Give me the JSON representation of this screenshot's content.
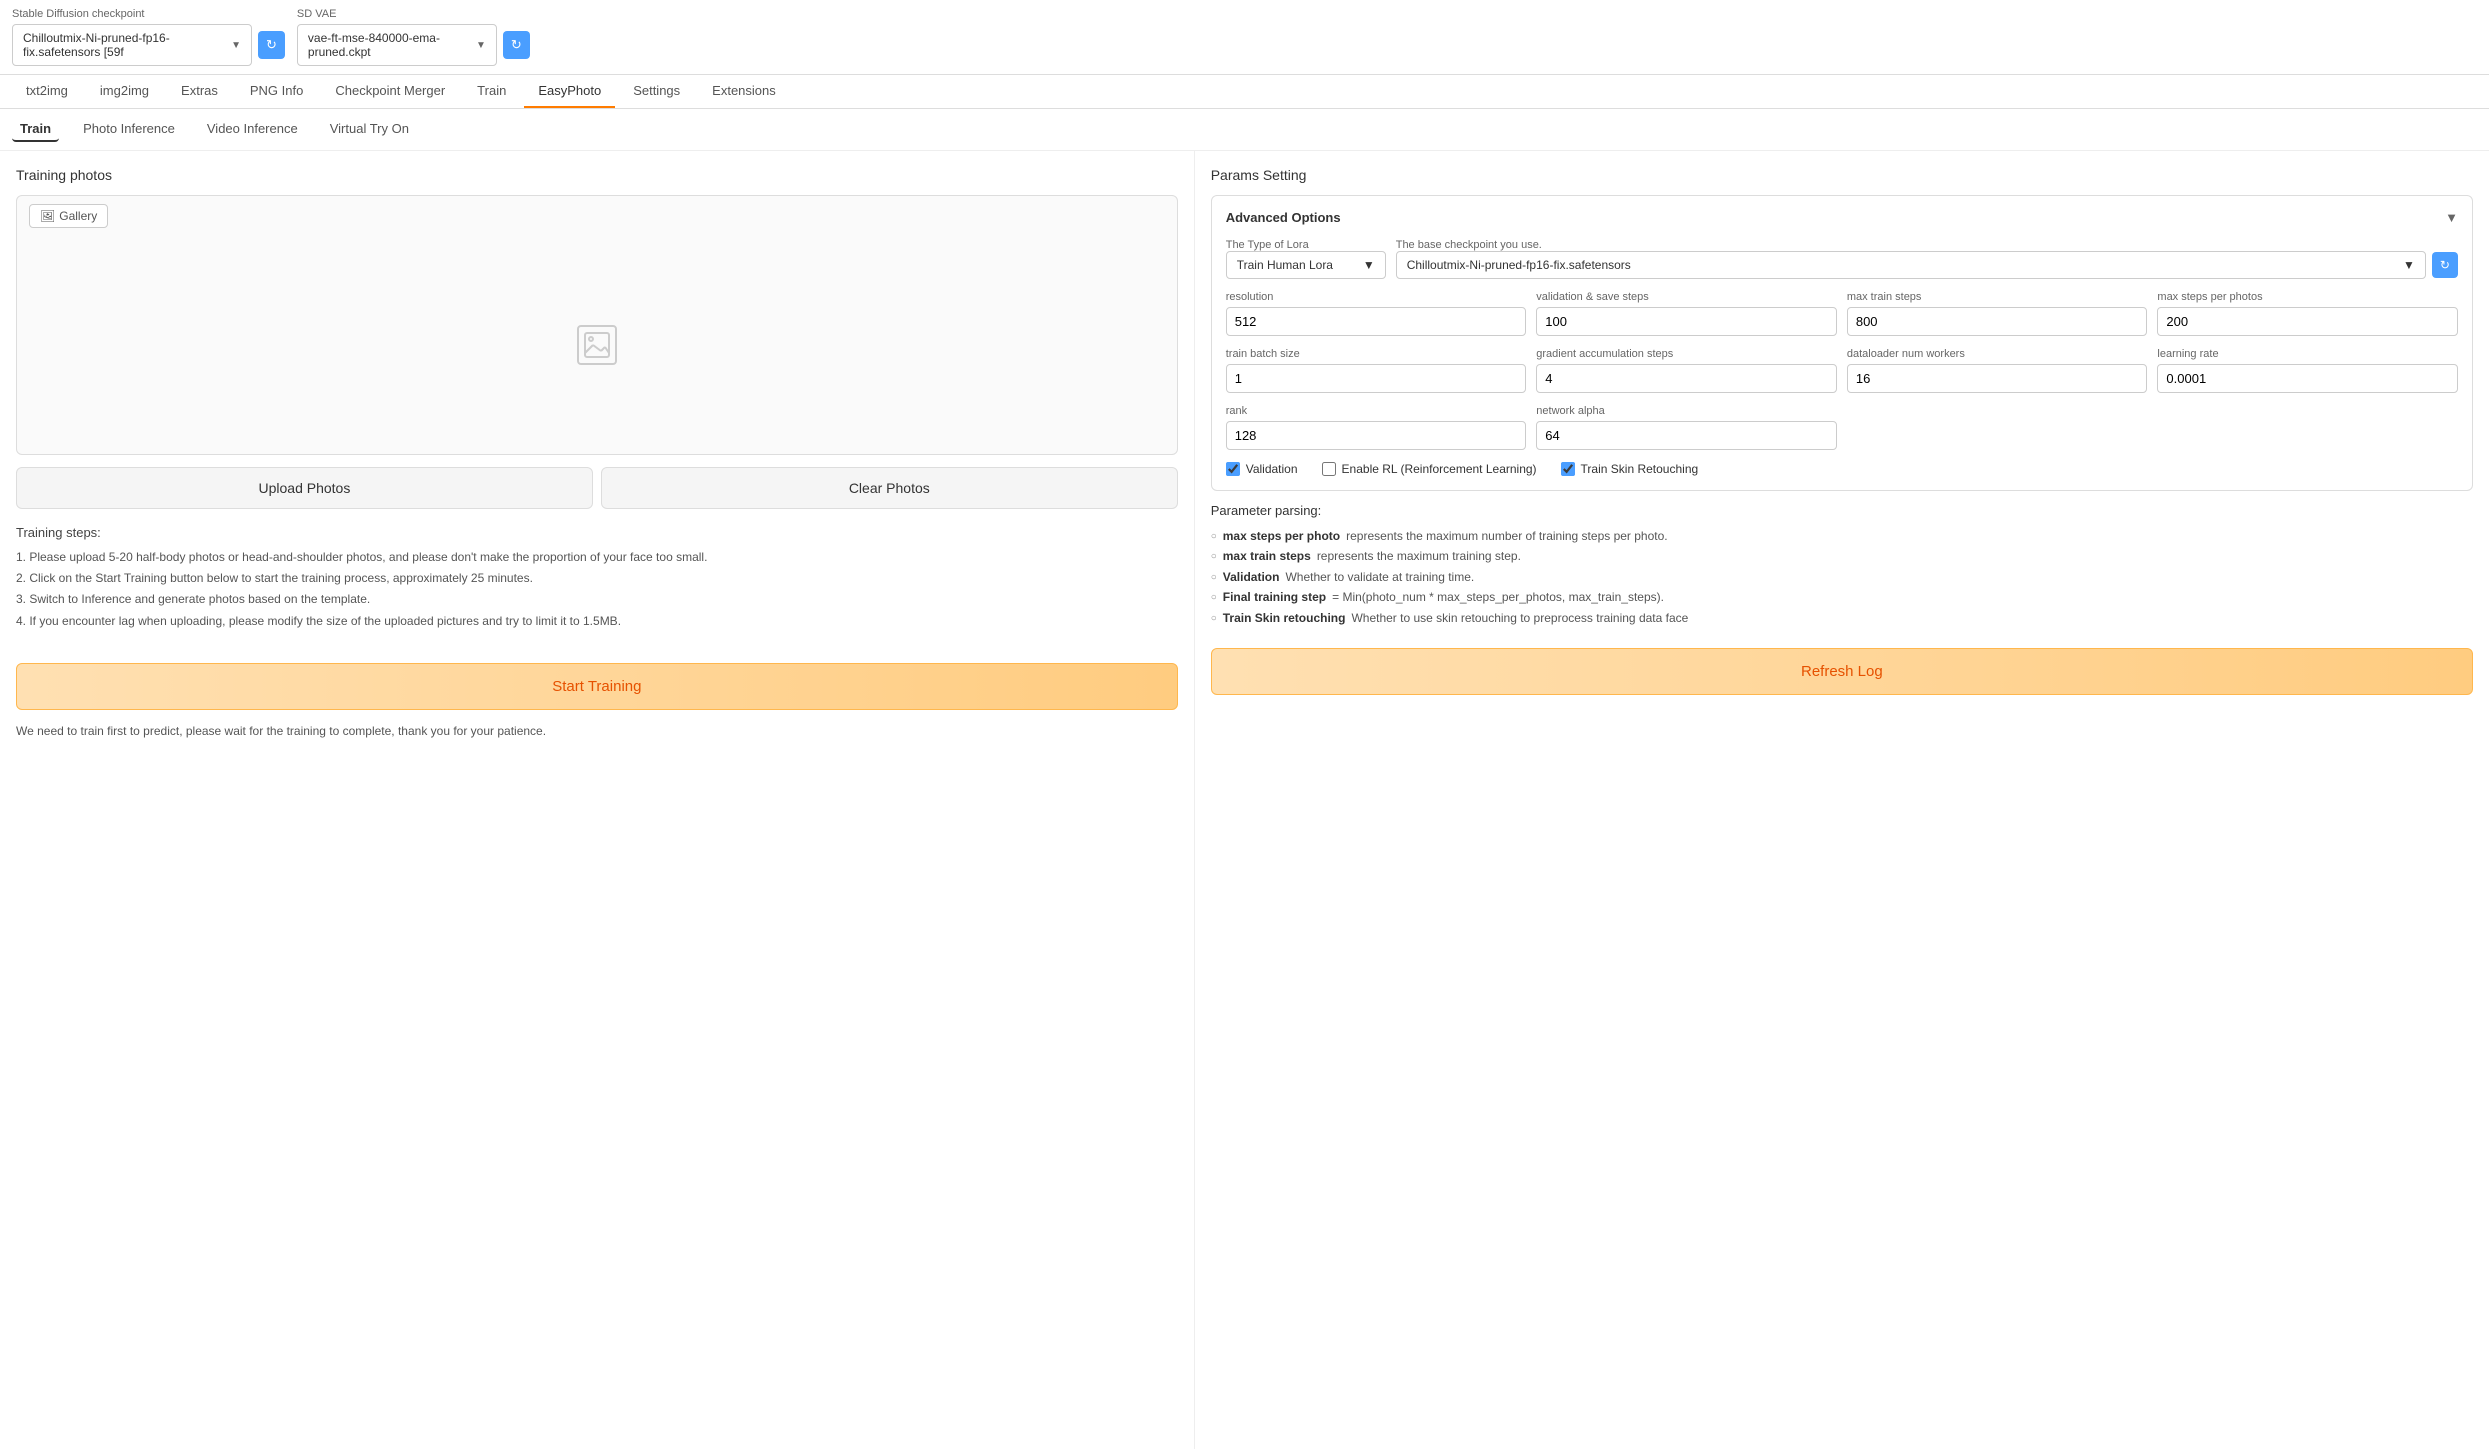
{
  "topBar": {
    "checkpointLabel": "Stable Diffusion checkpoint",
    "vaeLabel": "SD VAE",
    "checkpointValue": "Chilloutmix-Ni-pruned-fp16-fix.safetensors [59f",
    "vaeValue": "vae-ft-mse-840000-ema-pruned.ckpt"
  },
  "navTabs": [
    {
      "label": "txt2img",
      "active": false
    },
    {
      "label": "img2img",
      "active": false
    },
    {
      "label": "Extras",
      "active": false
    },
    {
      "label": "PNG Info",
      "active": false
    },
    {
      "label": "Checkpoint Merger",
      "active": false
    },
    {
      "label": "Train",
      "active": false
    },
    {
      "label": "EasyPhoto",
      "active": true
    },
    {
      "label": "Settings",
      "active": false
    },
    {
      "label": "Extensions",
      "active": false
    }
  ],
  "subTabs": [
    {
      "label": "Train",
      "active": true
    },
    {
      "label": "Photo Inference",
      "active": false
    },
    {
      "label": "Video Inference",
      "active": false
    },
    {
      "label": "Virtual Try On",
      "active": false
    }
  ],
  "leftPanel": {
    "title": "Training photos",
    "galleryBtn": "Gallery",
    "uploadBtn": "Upload Photos",
    "clearBtn": "Clear Photos",
    "stepsTitle": "Training steps:",
    "steps": [
      "1. Please upload 5-20 half-body photos or head-and-shoulder photos, and please don't make the proportion of your face too small.",
      "2. Click on the Start Training button below to start the training process, approximately 25 minutes.",
      "3. Switch to Inference and generate photos based on the template.",
      "4. If you encounter lag when uploading, please modify the size of the uploaded pictures and try to limit it to 1.5MB."
    ],
    "startTrainingBtn": "Start Training",
    "bottomMessage": "We need to train first to predict, please wait for the training to complete, thank you for your patience."
  },
  "rightPanel": {
    "paramsTitle": "Params Setting",
    "advancedTitle": "Advanced Options",
    "loraTypeLabel": "The Type of Lora",
    "loraTypeValue": "Train Human Lora",
    "baseCheckpointLabel": "The base checkpoint you use.",
    "baseCheckpointValue": "Chilloutmix-Ni-pruned-fp16-fix.safetensors",
    "fields": {
      "resolution": {
        "label": "resolution",
        "value": "512"
      },
      "validationSaveSteps": {
        "label": "validation & save steps",
        "value": "100"
      },
      "maxTrainSteps": {
        "label": "max train steps",
        "value": "800"
      },
      "maxStepsPerPhoto": {
        "label": "max steps per photos",
        "value": "200"
      },
      "trainBatchSize": {
        "label": "train batch size",
        "value": "1"
      },
      "gradientAccumulationSteps": {
        "label": "gradient accumulation steps",
        "value": "4"
      },
      "dataloaderNumWorkers": {
        "label": "dataloader num workers",
        "value": "16"
      },
      "learningRate": {
        "label": "learning rate",
        "value": "0.0001"
      },
      "rank": {
        "label": "rank",
        "value": "128"
      },
      "networkAlpha": {
        "label": "network alpha",
        "value": "64"
      }
    },
    "checkboxes": {
      "validation": {
        "label": "Validation",
        "checked": true
      },
      "enableRL": {
        "label": "Enable RL (Reinforcement Learning)",
        "checked": false
      },
      "trainSkinRetouching": {
        "label": "Train Skin Retouching",
        "checked": true
      }
    },
    "parsingTitle": "Parameter parsing:",
    "parsingItems": [
      {
        "bold": "max steps per photo",
        "text": " represents the maximum number of training steps per photo."
      },
      {
        "bold": "max train steps",
        "text": " represents the maximum training step."
      },
      {
        "bold": "Validation",
        "text": " Whether to validate at training time."
      },
      {
        "bold": "Final training step",
        "text": " = Min(photo_num * max_steps_per_photos, max_train_steps)."
      },
      {
        "bold": "Train Skin retouching",
        "text": " Whether to use skin retouching to preprocess training data face"
      }
    ],
    "refreshLogBtn": "Refresh Log"
  }
}
